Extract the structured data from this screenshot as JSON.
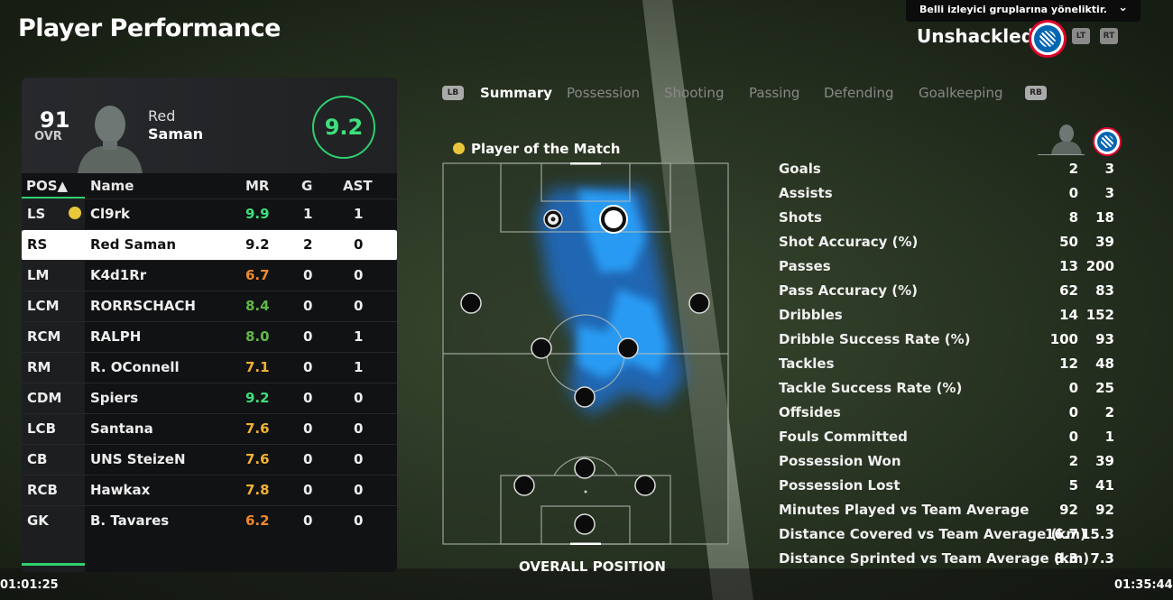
{
  "header": {
    "title": "Player Performance",
    "notice": "Belli izleyici gruplarına yöneliktir.",
    "team_name": "Unshackled",
    "lt": "LT",
    "rt": "RT"
  },
  "player_card": {
    "ovr": "91",
    "ovr_label": "OVR",
    "first_name": "Red",
    "last_name": "Saman",
    "match_rating": "9.2"
  },
  "table": {
    "headers": {
      "pos": "POS▲",
      "name": "Name",
      "mr": "MR",
      "g": "G",
      "ast": "AST"
    },
    "rows": [
      {
        "pos": "LS",
        "name": "Cl9rk",
        "mr": "9.9",
        "g": "1",
        "ast": "1",
        "mr_color": "#3de07c",
        "motm": true
      },
      {
        "pos": "RS",
        "name": "Red Saman",
        "mr": "9.2",
        "g": "2",
        "ast": "0",
        "mr_color": "#111111",
        "selected": true
      },
      {
        "pos": "LM",
        "name": "K4d1Rr",
        "mr": "6.7",
        "g": "0",
        "ast": "0",
        "mr_color": "#f08a2c"
      },
      {
        "pos": "LCM",
        "name": "RORRSCHACH",
        "mr": "8.4",
        "g": "0",
        "ast": "0",
        "mr_color": "#5fb845"
      },
      {
        "pos": "RCM",
        "name": "RALPH",
        "mr": "8.0",
        "g": "0",
        "ast": "1",
        "mr_color": "#5fb845"
      },
      {
        "pos": "RM",
        "name": "R. OConnell",
        "mr": "7.1",
        "g": "0",
        "ast": "1",
        "mr_color": "#f2b233"
      },
      {
        "pos": "CDM",
        "name": "Spiers",
        "mr": "9.2",
        "g": "0",
        "ast": "0",
        "mr_color": "#3de07c"
      },
      {
        "pos": "LCB",
        "name": "Santana",
        "mr": "7.6",
        "g": "0",
        "ast": "0",
        "mr_color": "#f2b233"
      },
      {
        "pos": "CB",
        "name": "UNS SteizeN",
        "mr": "7.6",
        "g": "0",
        "ast": "0",
        "mr_color": "#f2b233"
      },
      {
        "pos": "RCB",
        "name": "Hawkax",
        "mr": "7.8",
        "g": "0",
        "ast": "0",
        "mr_color": "#f2b233"
      },
      {
        "pos": "GK",
        "name": "B. Tavares",
        "mr": "6.2",
        "g": "0",
        "ast": "0",
        "mr_color": "#f08a2c"
      }
    ]
  },
  "tabs": {
    "lb": "LB",
    "rb": "RB",
    "items": [
      "Summary",
      "Possession",
      "Shooting",
      "Passing",
      "Defending",
      "Goalkeeping"
    ],
    "active": "Summary"
  },
  "pitch": {
    "motm_label": "Player of the Match",
    "overall_label": "OVERALL POSITION"
  },
  "stats": [
    {
      "label": "Goals",
      "player": "2",
      "team": "3"
    },
    {
      "label": "Assists",
      "player": "0",
      "team": "3"
    },
    {
      "label": "Shots",
      "player": "8",
      "team": "18"
    },
    {
      "label": "Shot Accuracy (%)",
      "player": "50",
      "team": "39"
    },
    {
      "label": "Passes",
      "player": "13",
      "team": "200"
    },
    {
      "label": "Pass Accuracy (%)",
      "player": "62",
      "team": "83"
    },
    {
      "label": "Dribbles",
      "player": "14",
      "team": "152"
    },
    {
      "label": "Dribble Success Rate (%)",
      "player": "100",
      "team": "93"
    },
    {
      "label": "Tackles",
      "player": "12",
      "team": "48"
    },
    {
      "label": "Tackle Success Rate (%)",
      "player": "0",
      "team": "25"
    },
    {
      "label": "Offsides",
      "player": "0",
      "team": "2"
    },
    {
      "label": "Fouls Committed",
      "player": "0",
      "team": "1"
    },
    {
      "label": "Possession Won",
      "player": "2",
      "team": "39"
    },
    {
      "label": "Possession Lost",
      "player": "5",
      "team": "41"
    },
    {
      "label": "Minutes Played vs Team Average",
      "player": "92",
      "team": "92"
    },
    {
      "label": "Distance Covered vs Team Average (km)",
      "player": "16.7",
      "team": "15.3"
    },
    {
      "label": "Distance Sprinted vs Team Average (km)",
      "player": "8.3",
      "team": "7.3"
    }
  ],
  "video": {
    "time_left": "01:01:25",
    "time_right": "01:35:44"
  },
  "colors": {
    "accent": "#2ed06e",
    "heatmap": "#1a8cff"
  }
}
